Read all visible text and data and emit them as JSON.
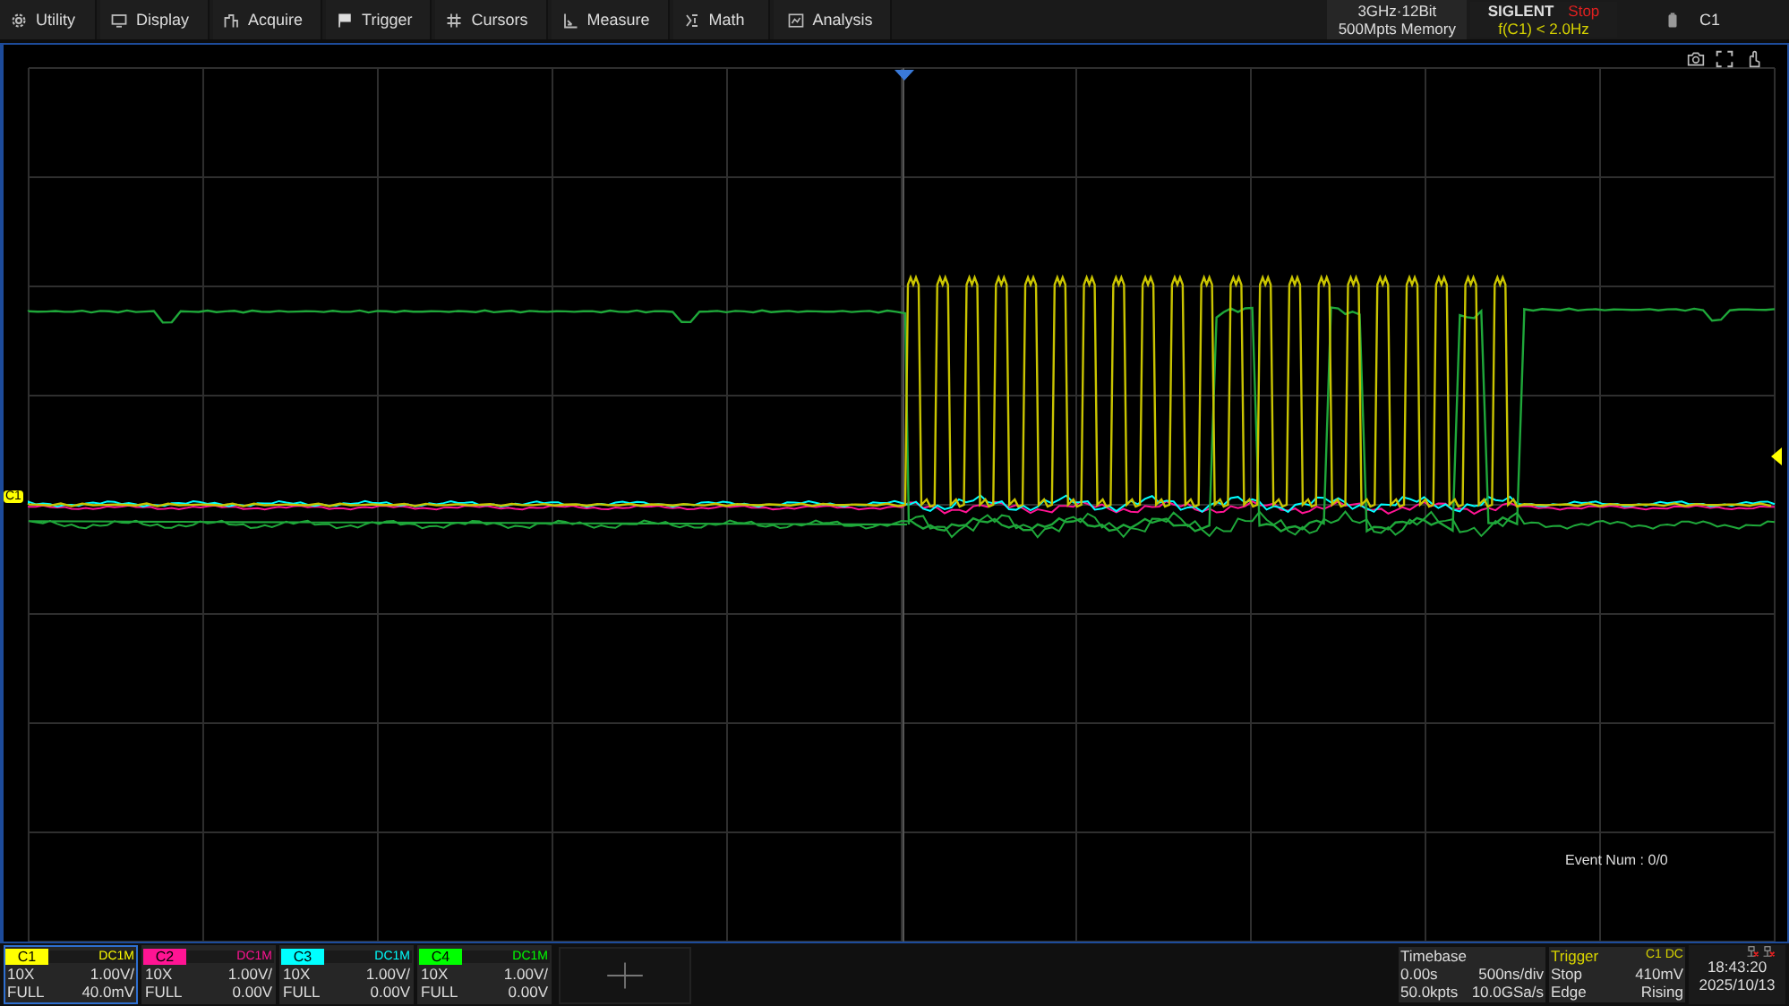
{
  "menu": [
    {
      "label": "Utility"
    },
    {
      "label": "Display"
    },
    {
      "label": "Acquire"
    },
    {
      "label": "Trigger"
    },
    {
      "label": "Cursors"
    },
    {
      "label": "Measure"
    },
    {
      "label": "Math"
    },
    {
      "label": "Analysis"
    }
  ],
  "header": {
    "spec_line": "3GHz·12Bit",
    "memory": "500Mpts Memory",
    "brand": "SIGLENT",
    "run_state": "Stop",
    "frequency": "f(C1) < 2.0Hz",
    "active_channel": "C1"
  },
  "plot": {
    "channel_marker": "C1",
    "event_num": "Event Num : 0/0"
  },
  "channels": [
    {
      "name": "C1",
      "coupling": "DC1M",
      "probe": "10X",
      "scale": "1.00V/",
      "bandwidth": "FULL",
      "offset": "40.0mV",
      "color": "#ffff00",
      "selected": true
    },
    {
      "name": "C2",
      "coupling": "DC1M",
      "probe": "10X",
      "scale": "1.00V/",
      "bandwidth": "FULL",
      "offset": "0.00V",
      "color": "#ff1493",
      "selected": false
    },
    {
      "name": "C3",
      "coupling": "DC1M",
      "probe": "10X",
      "scale": "1.00V/",
      "bandwidth": "FULL",
      "offset": "0.00V",
      "color": "#00ffff",
      "selected": false
    },
    {
      "name": "C4",
      "coupling": "DC1M",
      "probe": "10X",
      "scale": "1.00V/",
      "bandwidth": "FULL",
      "offset": "0.00V",
      "color": "#00ff00",
      "selected": false
    }
  ],
  "timebase": {
    "title": "Timebase",
    "delay": "0.00s",
    "scale": "500ns/div",
    "points": "50.0kpts",
    "rate": "10.0GSa/s"
  },
  "trigger": {
    "title": "Trigger",
    "source": "C1 DC",
    "mode": "Stop",
    "level": "410mV",
    "type": "Edge",
    "slope": "Rising"
  },
  "clock": {
    "time": "18:43:20",
    "date": "2025/10/13"
  }
}
